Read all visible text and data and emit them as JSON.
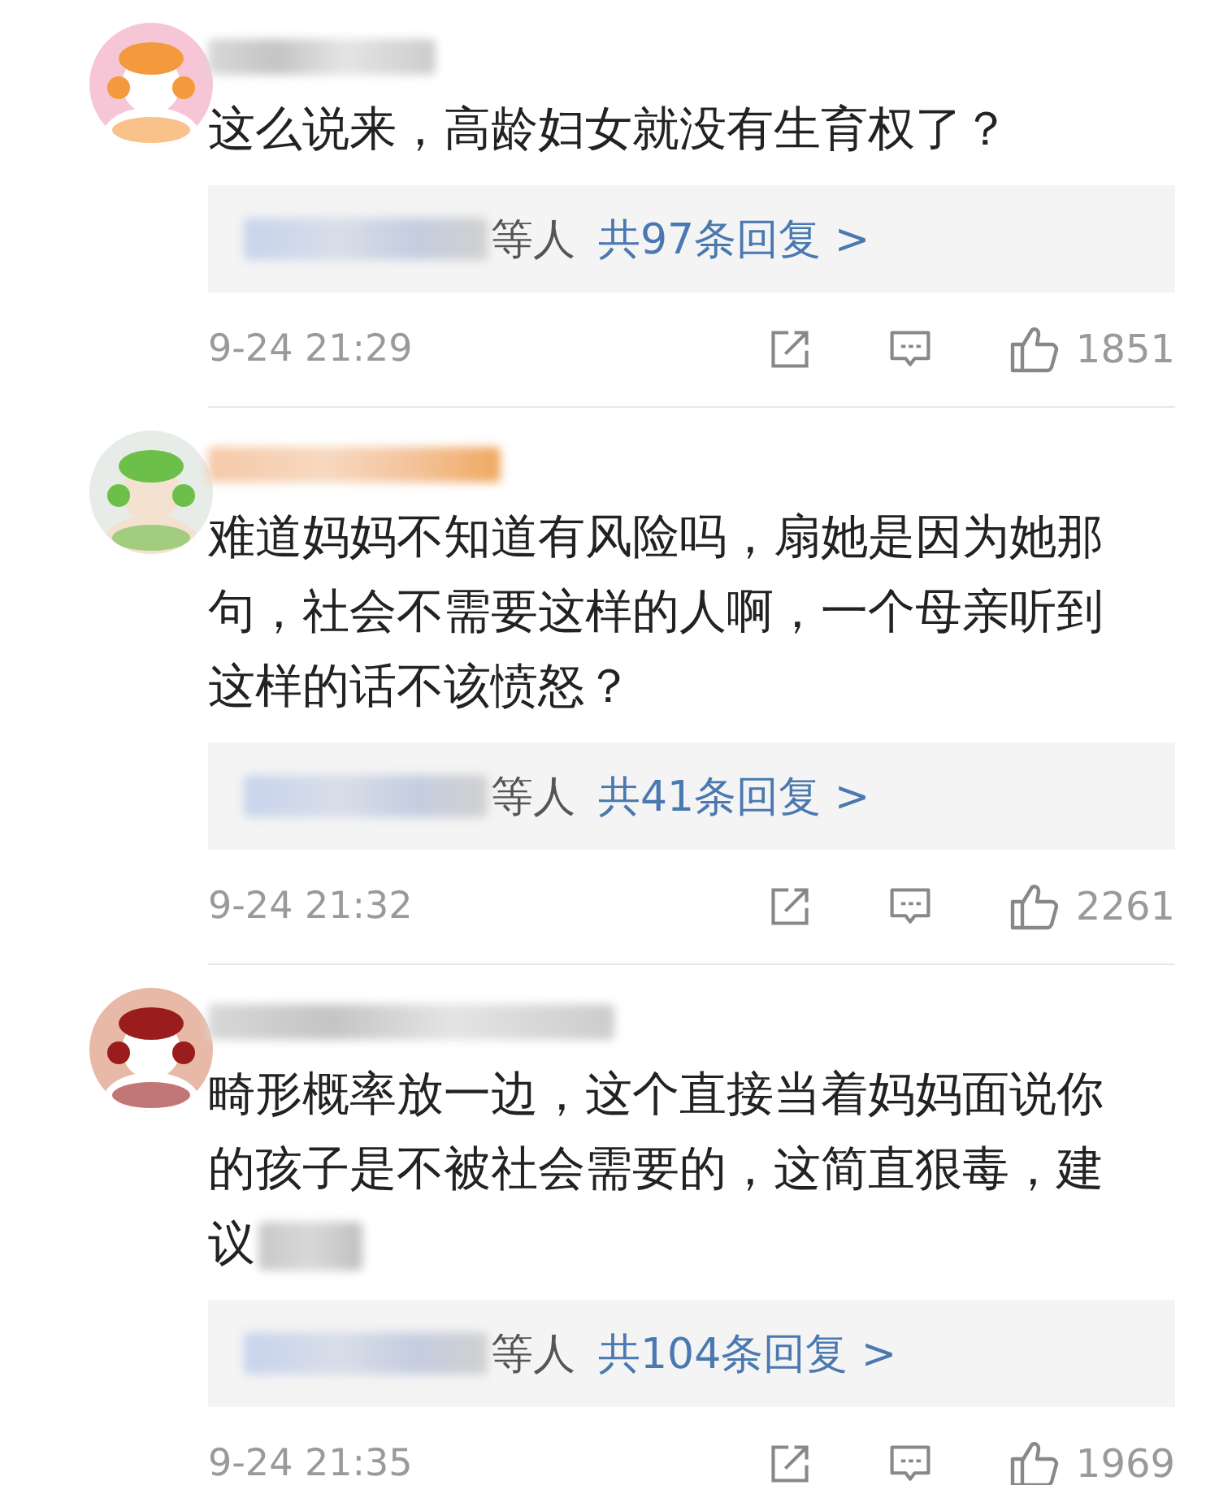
{
  "comments": [
    {
      "text": "这么说来，高龄妇女就没有生育权了？",
      "censored_tail": false,
      "reply_suffix": "等人",
      "reply_link": "共97条回复 >",
      "time": "9-24 21:29",
      "likes": "1851"
    },
    {
      "text": "难道妈妈不知道有风险吗，扇她是因为她那句，社会不需要这样的人啊，一个母亲听到这样的话不该愤怒？",
      "censored_tail": false,
      "reply_suffix": "等人",
      "reply_link": "共41条回复 >",
      "time": "9-24 21:32",
      "likes": "2261"
    },
    {
      "text": "畸形概率放一边，这个直接当着妈妈面说你的孩子是不被社会需要的，这简直狠毒，建议",
      "censored_tail": true,
      "reply_suffix": "等人",
      "reply_link": "共104条回复 >",
      "time": "9-24 21:35",
      "likes": "1969"
    }
  ]
}
